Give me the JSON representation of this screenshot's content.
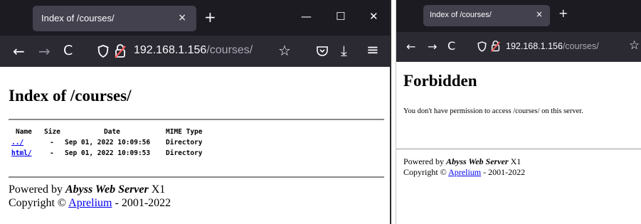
{
  "left_window": {
    "tab_title": "Index of /courses/",
    "url_host": "192.168.1.156",
    "url_path": "/courses/",
    "page": {
      "heading": "Index of /courses/",
      "columns": [
        "Name",
        "Size",
        "Date",
        "MIME Type"
      ],
      "rows": [
        {
          "name": "../",
          "size": "-",
          "date": "Sep 01, 2022 10:09:56",
          "type": "Directory"
        },
        {
          "name": "html/",
          "size": "-",
          "date": "Sep 01, 2022 10:09:53",
          "type": "Directory"
        }
      ],
      "powered_prefix": "Powered by ",
      "server_name": "Abyss Web Server",
      "server_version": " X1",
      "copyright_prefix": "Copyright © ",
      "copyright_link": "Aprelium",
      "copyright_years": " - 2001-2022"
    }
  },
  "right_window": {
    "tab_title": "Index of /courses/",
    "url_host": "192.168.1.156",
    "url_path": "/courses/",
    "page": {
      "heading": "Forbidden",
      "message": "You don't have permission to access /courses/ on this server.",
      "powered_prefix": "Powered by ",
      "server_name": "Abyss Web Server",
      "server_version": " X1",
      "copyright_prefix": "Copyright © ",
      "copyright_link": "Aprelium",
      "copyright_years": " - 2001-2022"
    }
  },
  "colors": {
    "tab_strip": "#1c1b22",
    "active_tab": "#42414d",
    "toolbar": "#2b2a33",
    "insecure_lock": "#ff5a5a",
    "link": "#0000ee"
  },
  "icons": {
    "tab_close": "×",
    "new_tab": "+",
    "minimize": "—",
    "maximize": "☐",
    "close": "✕",
    "back": "←",
    "forward": "→",
    "reload": "C",
    "shield": "shield-icon",
    "lock": "insecure-lock-icon",
    "star": "☆",
    "pocket": "pocket-icon",
    "download": "⤓",
    "menu": "≡"
  }
}
